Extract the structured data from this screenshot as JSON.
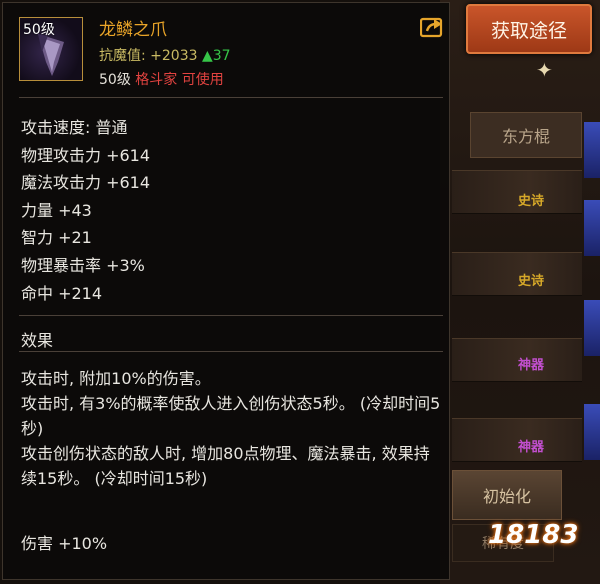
{
  "item": {
    "level_badge": "50级",
    "name": "龙鳞之爪",
    "resist_label": "抗魔值: +2033",
    "resist_bonus": "▲37",
    "req_level": "50级",
    "req_class": "格斗家 可使用"
  },
  "stats": [
    "攻击速度: 普通",
    "物理攻击力 +614",
    "魔法攻击力 +614",
    "力量 +43",
    "智力 +21",
    "物理暴击率 +3%",
    "命中 +214"
  ],
  "effect_section": {
    "title": "效果",
    "lines": [
      "攻击时, 附加10%的伤害。",
      "攻击时, 有3%的概率使敌人进入创伤状态5秒。 (冷却时间5秒)",
      "攻击创伤状态的敌人时, 增加80点物理、魔法暴击, 效果持续15秒。 (冷却时间15秒)"
    ],
    "damage": "伤害 +10%"
  },
  "side": {
    "acquire_button": "获取途径",
    "tab_label": "东方棍",
    "tags": [
      "史诗",
      "史诗",
      "神器",
      "神器"
    ],
    "reset_button": "初始化",
    "rare_button": "稀有度"
  },
  "watermark": "18183",
  "colors": {
    "item_name": "#e9a428",
    "resist_up": "#36c548",
    "class_req": "#e24340",
    "epic": "#d6a829",
    "artifact": "#c24fcf"
  }
}
